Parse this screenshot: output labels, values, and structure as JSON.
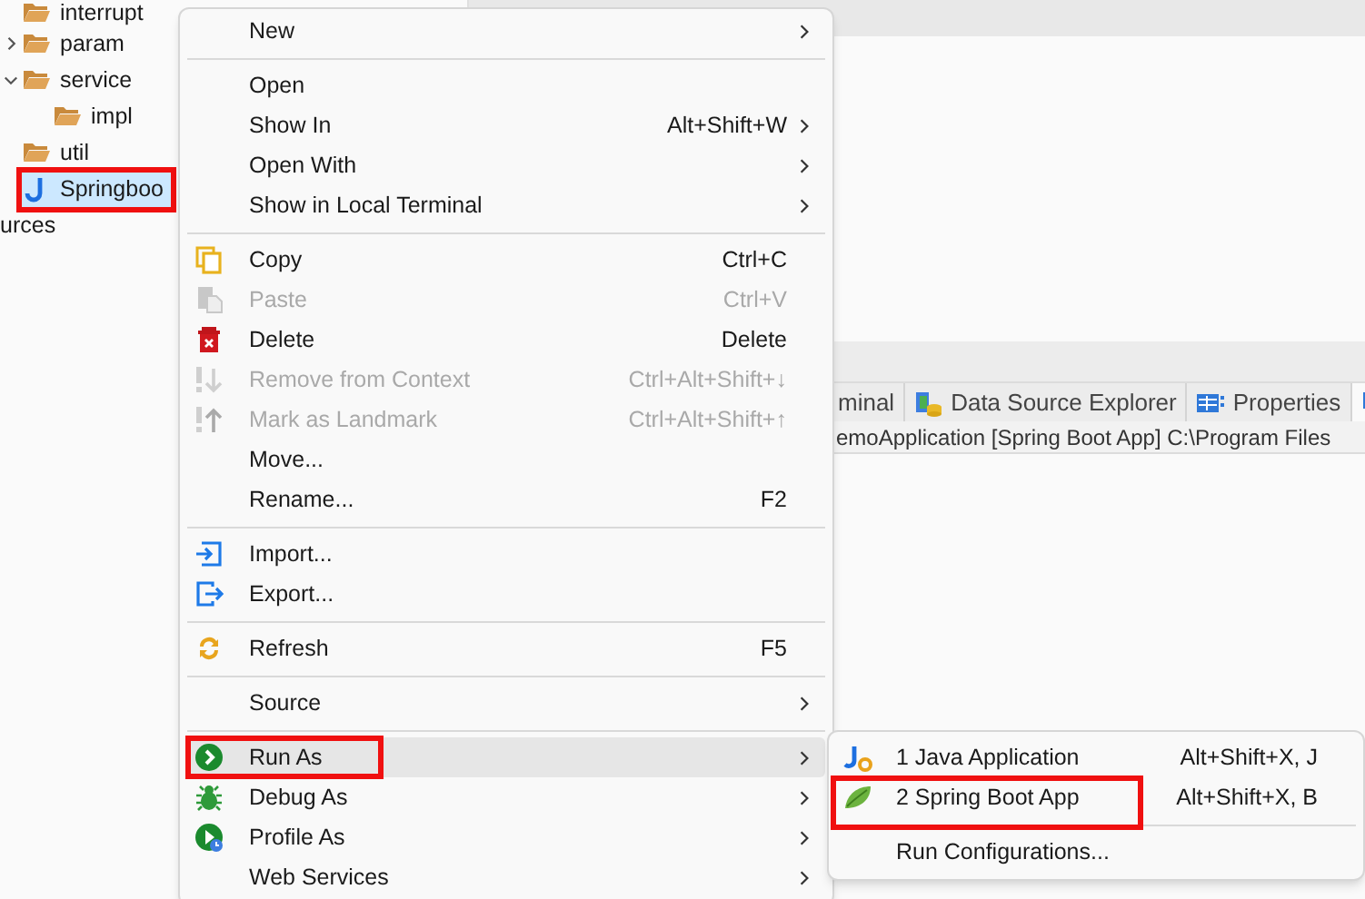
{
  "project_tree": [
    {
      "label": "interrupt",
      "kind": "folder",
      "selected": false,
      "highlighted": false
    },
    {
      "label": "param",
      "kind": "folder",
      "expanded": false,
      "selected": false,
      "highlighted": false
    },
    {
      "label": "service",
      "kind": "folder",
      "expanded": true,
      "selected": false,
      "highlighted": false,
      "children": [
        {
          "label": "impl",
          "kind": "folder",
          "selected": false,
          "highlighted": false
        }
      ]
    },
    {
      "label": "util",
      "kind": "folder",
      "selected": false,
      "highlighted": false
    },
    {
      "label": "Springboo",
      "kind": "java",
      "selected": true,
      "highlighted": true
    }
  ],
  "cut_tree_label": "urces",
  "view_tabs": [
    {
      "label": "minal",
      "selected": false
    },
    {
      "label": "Data Source Explorer",
      "selected": false
    },
    {
      "label": "Properties",
      "selected": false
    },
    {
      "selected": true
    }
  ],
  "console_title": "emoApplication [Spring Boot App] C:\\Program Files",
  "context_menu": {
    "items": [
      {
        "kind": "item",
        "label": "New",
        "submenu": true,
        "disabled": false,
        "hovered": false,
        "highlighted": false
      },
      {
        "kind": "separator"
      },
      {
        "kind": "item",
        "label": "Open",
        "submenu": false,
        "disabled": false,
        "hovered": false,
        "highlighted": false
      },
      {
        "kind": "item",
        "label": "Show In",
        "shortcut": "Alt+Shift+W",
        "submenu": true,
        "disabled": false,
        "hovered": false,
        "highlighted": false
      },
      {
        "kind": "item",
        "label": "Open With",
        "submenu": true,
        "disabled": false,
        "hovered": false,
        "highlighted": false
      },
      {
        "kind": "item",
        "label": "Show in Local Terminal",
        "submenu": true,
        "disabled": false,
        "hovered": false,
        "highlighted": false
      },
      {
        "kind": "separator"
      },
      {
        "kind": "item",
        "label": "Copy",
        "shortcut": "Ctrl+C",
        "submenu": false,
        "disabled": false,
        "hovered": false,
        "highlighted": false
      },
      {
        "kind": "item",
        "label": "Paste",
        "shortcut": "Ctrl+V",
        "submenu": false,
        "disabled": true,
        "hovered": false,
        "highlighted": false
      },
      {
        "kind": "item",
        "label": "Delete",
        "shortcut": "Delete",
        "submenu": false,
        "disabled": false,
        "hovered": false,
        "highlighted": false
      },
      {
        "kind": "item",
        "label": "Remove from Context",
        "shortcut": "Ctrl+Alt+Shift+↓",
        "submenu": false,
        "disabled": true,
        "hovered": false,
        "highlighted": false
      },
      {
        "kind": "item",
        "label": "Mark as Landmark",
        "shortcut": "Ctrl+Alt+Shift+↑",
        "submenu": false,
        "disabled": true,
        "hovered": false,
        "highlighted": false
      },
      {
        "kind": "item",
        "label": "Move...",
        "submenu": false,
        "disabled": false,
        "hovered": false,
        "highlighted": false
      },
      {
        "kind": "item",
        "label": "Rename...",
        "shortcut": "F2",
        "submenu": false,
        "disabled": false,
        "hovered": false,
        "highlighted": false
      },
      {
        "kind": "separator"
      },
      {
        "kind": "item",
        "label": "Import...",
        "submenu": false,
        "disabled": false,
        "hovered": false,
        "highlighted": false
      },
      {
        "kind": "item",
        "label": "Export...",
        "submenu": false,
        "disabled": false,
        "hovered": false,
        "highlighted": false
      },
      {
        "kind": "separator"
      },
      {
        "kind": "item",
        "label": "Refresh",
        "shortcut": "F5",
        "submenu": false,
        "disabled": false,
        "hovered": false,
        "highlighted": false
      },
      {
        "kind": "separator"
      },
      {
        "kind": "item",
        "label": "Source",
        "submenu": true,
        "disabled": false,
        "hovered": false,
        "highlighted": false
      },
      {
        "kind": "separator"
      },
      {
        "kind": "item",
        "label": "Run As",
        "submenu": true,
        "disabled": false,
        "hovered": true,
        "highlighted": true
      },
      {
        "kind": "item",
        "label": "Debug As",
        "submenu": true,
        "disabled": false,
        "hovered": false,
        "highlighted": false
      },
      {
        "kind": "item",
        "label": "Profile As",
        "submenu": true,
        "disabled": false,
        "hovered": false,
        "highlighted": false
      },
      {
        "kind": "item",
        "label": "Web Services",
        "submenu": true,
        "disabled": false,
        "hovered": false,
        "highlighted": false
      }
    ]
  },
  "run_as_submenu": {
    "items": [
      {
        "kind": "item",
        "label": "1 Java Application",
        "shortcut": "Alt+Shift+X, J",
        "highlighted": false
      },
      {
        "kind": "item",
        "label": "2 Spring Boot App",
        "shortcut": "Alt+Shift+X, B",
        "highlighted": true
      },
      {
        "kind": "separator"
      },
      {
        "kind": "item",
        "label": "Run Configurations...",
        "highlighted": false
      }
    ]
  }
}
